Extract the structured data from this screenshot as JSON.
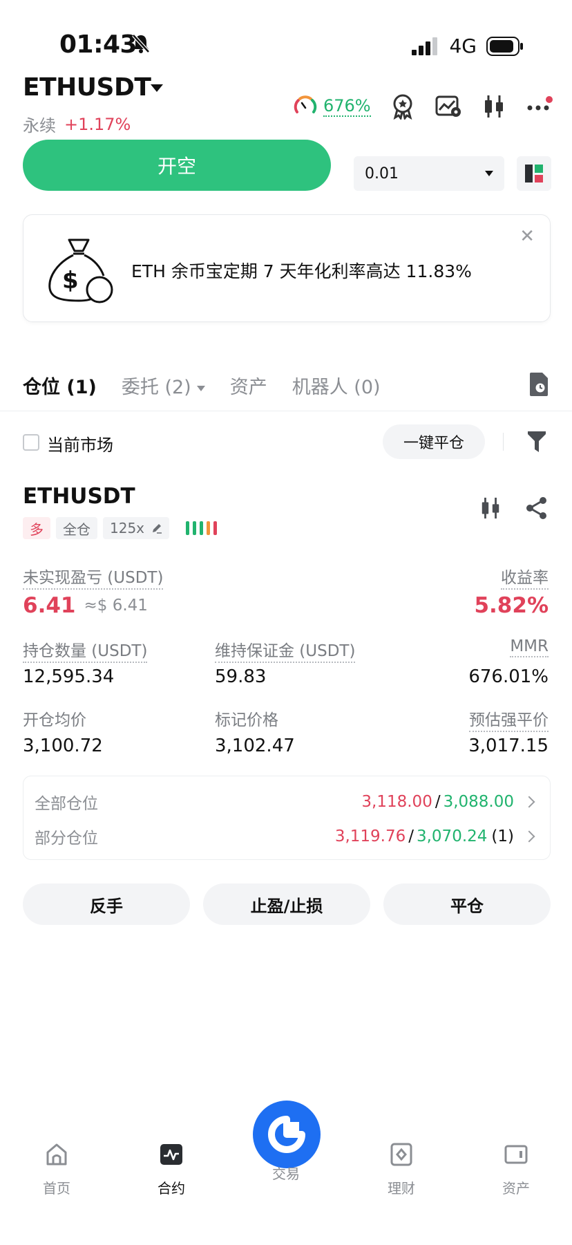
{
  "status_bar": {
    "time": "01:43",
    "network": "4G"
  },
  "header": {
    "pair": "ETHUSDT",
    "type": "永续",
    "change": "+1.17%",
    "mmr": "676%"
  },
  "order": {
    "open_label": "开空",
    "quantity": "0.01"
  },
  "banner": {
    "text": "ETH 余币宝定期 7 天年化利率高达 11.83%"
  },
  "tabs": [
    {
      "label": "仓位 (1)"
    },
    {
      "label": "委托 (2)"
    },
    {
      "label": "资产"
    },
    {
      "label": "机器人 (0)"
    }
  ],
  "filter": {
    "current_market": "当前市场",
    "close_all": "一键平仓"
  },
  "position": {
    "symbol": "ETHUSDT",
    "side": "多",
    "margin_mode": "全仓",
    "leverage": "125x",
    "pnl_label": "未实现盈亏 (USDT)",
    "pnl": "6.41",
    "pnl_usd": "≈$ 6.41",
    "roe_label": "收益率",
    "roe": "5.82%",
    "size_label": "持仓数量 (USDT)",
    "size": "12,595.34",
    "maint_label": "维持保证金 (USDT)",
    "maint": "59.83",
    "mmr_label": "MMR",
    "mmr": "676.01%",
    "entry_label": "开仓均价",
    "entry": "3,100.72",
    "mark_label": "标记价格",
    "mark": "3,102.47",
    "liq_label": "预估强平价",
    "liq": "3,017.15",
    "tpsl": {
      "all_label": "全部仓位",
      "all_tp": "3,118.00",
      "all_sl": "3,088.00",
      "partial_label": "部分仓位",
      "partial_tp": "3,119.76",
      "partial_sl": "3,070.24",
      "partial_count": "(1)",
      "sep": "/"
    },
    "actions": {
      "reverse": "反手",
      "tpsl": "止盈/止损",
      "close": "平仓"
    }
  },
  "nav": [
    {
      "label": "首页"
    },
    {
      "label": "合约"
    },
    {
      "label": "交易"
    },
    {
      "label": "理财"
    },
    {
      "label": "资产"
    }
  ],
  "colors": {
    "green": "#21b36e",
    "red": "#e0425a",
    "orange": "#f2943a",
    "blue": "#1e6ff2"
  }
}
